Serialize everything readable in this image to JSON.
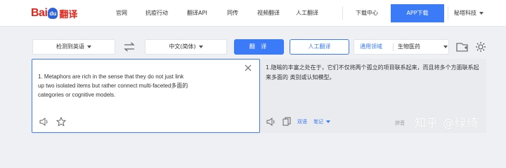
{
  "logo": {
    "part1": "Bai",
    "part2": "du",
    "part3": "翻译"
  },
  "nav": {
    "items": [
      "官网",
      "抗疫行动",
      "翻译API",
      "同传",
      "视频翻译",
      "人工翻译"
    ],
    "download": "下载中心",
    "app": "APP下载",
    "more": "秘塔科技"
  },
  "toolbar": {
    "source_lang": "检测到英语",
    "target_lang": "中文(简体)",
    "translate_label": "翻 译",
    "human_label": "人工翻译",
    "domain_label": "通用领域",
    "domain_value": "生物医药"
  },
  "source": {
    "text": "1. Metaphors are rich in the sense that they do not just link\nup two isolated items but rather connect multi-faceted多面的\ncategories or cognitive models."
  },
  "target": {
    "text": "1.隐喻的丰富之处在于，它们不仅将两个孤立的项目联系起来，而且将多个方面联系起来多面的 类别或认知模型。",
    "bilingual": "双语",
    "notes": "笔记",
    "partial": "拼音"
  },
  "watermark": "知乎 @绿绮",
  "colors": {
    "accent": "#3c7bf7",
    "brand_red": "#e1251b"
  }
}
